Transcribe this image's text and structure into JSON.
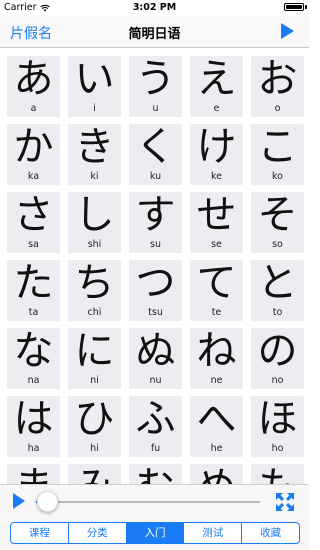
{
  "status_bar": {
    "carrier": "Carrier",
    "time": "3:02 PM"
  },
  "nav": {
    "left_label": "片假名",
    "title": "简明日语"
  },
  "grid": [
    {
      "kana": "あ",
      "romaji": "a"
    },
    {
      "kana": "い",
      "romaji": "i"
    },
    {
      "kana": "う",
      "romaji": "u"
    },
    {
      "kana": "え",
      "romaji": "e"
    },
    {
      "kana": "お",
      "romaji": "o"
    },
    {
      "kana": "か",
      "romaji": "ka"
    },
    {
      "kana": "き",
      "romaji": "ki"
    },
    {
      "kana": "く",
      "romaji": "ku"
    },
    {
      "kana": "け",
      "romaji": "ke"
    },
    {
      "kana": "こ",
      "romaji": "ko"
    },
    {
      "kana": "さ",
      "romaji": "sa"
    },
    {
      "kana": "し",
      "romaji": "shi"
    },
    {
      "kana": "す",
      "romaji": "su"
    },
    {
      "kana": "せ",
      "romaji": "se"
    },
    {
      "kana": "そ",
      "romaji": "so"
    },
    {
      "kana": "た",
      "romaji": "ta"
    },
    {
      "kana": "ち",
      "romaji": "chi"
    },
    {
      "kana": "つ",
      "romaji": "tsu"
    },
    {
      "kana": "て",
      "romaji": "te"
    },
    {
      "kana": "と",
      "romaji": "to"
    },
    {
      "kana": "な",
      "romaji": "na"
    },
    {
      "kana": "に",
      "romaji": "ni"
    },
    {
      "kana": "ぬ",
      "romaji": "nu"
    },
    {
      "kana": "ね",
      "romaji": "ne"
    },
    {
      "kana": "の",
      "romaji": "no"
    },
    {
      "kana": "は",
      "romaji": "ha"
    },
    {
      "kana": "ひ",
      "romaji": "hi"
    },
    {
      "kana": "ふ",
      "romaji": "fu"
    },
    {
      "kana": "へ",
      "romaji": "he"
    },
    {
      "kana": "ほ",
      "romaji": "ho"
    },
    {
      "kana": "ま",
      "romaji": ""
    },
    {
      "kana": "み",
      "romaji": ""
    },
    {
      "kana": "む",
      "romaji": ""
    },
    {
      "kana": "め",
      "romaji": ""
    },
    {
      "kana": "も",
      "romaji": ""
    }
  ],
  "player": {
    "progress": 0.0
  },
  "tabs": [
    {
      "label": "课程",
      "active": false
    },
    {
      "label": "分类",
      "active": false
    },
    {
      "label": "入门",
      "active": true
    },
    {
      "label": "测试",
      "active": false
    },
    {
      "label": "收藏",
      "active": false
    }
  ],
  "colors": {
    "accent": "#1a7cf4",
    "cell_background": "#ececf1"
  },
  "icons": {
    "nav_right": "play-icon",
    "player_left": "play-icon",
    "player_right": "fullscreen-expand-icon",
    "status_wifi": "wifi-icon",
    "status_battery": "battery-icon"
  }
}
